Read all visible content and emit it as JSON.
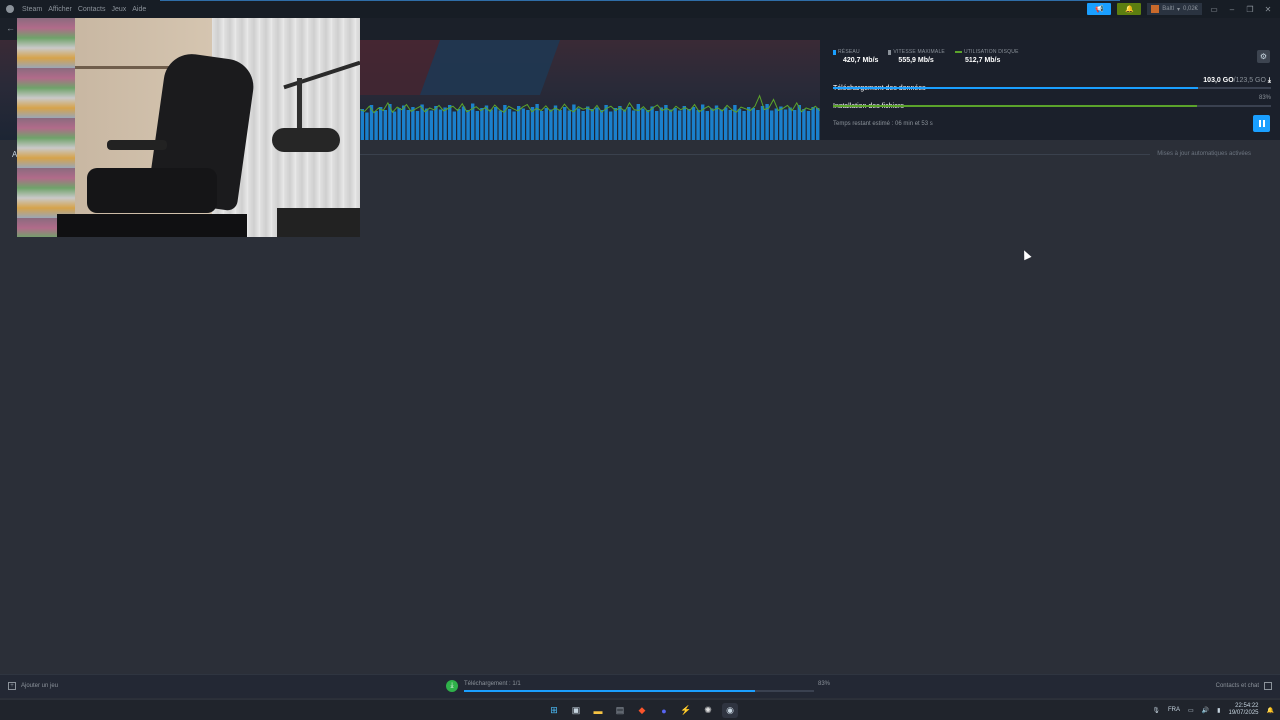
{
  "menu": {
    "items": [
      "Steam",
      "Afficher",
      "Contacts",
      "Jeux",
      "Aide"
    ]
  },
  "account": {
    "name": "Baltl",
    "balance": "0,02€"
  },
  "stats": {
    "network_label": "RÉSEAU",
    "network_value": "420,7 Mb/s",
    "max_speed_label": "VITESSE MAXIMALE",
    "max_speed_value": "555,9 Mb/s",
    "disk_label": "UTILISATION DISQUE",
    "disk_value": "512,7 Mb/s",
    "colors": {
      "network": "#1a9fff",
      "max": "#8b929a",
      "disk": "#5ba32b"
    }
  },
  "download": {
    "data_label": "Téléchargement des données",
    "data_done": "103,0 GO",
    "data_total": "/123,5 GO",
    "data_progress": 0.834,
    "install_label": "Installation des fichiers",
    "install_pct": "83%",
    "install_progress": 0.83,
    "eta": "Temps restant estimé : 06 min et 53 s"
  },
  "auto_updates": "Mises à jour automatiques activées",
  "section_letter": "A",
  "footer": {
    "add_game": "Ajouter un jeu",
    "download_status": "Téléchargement : 1/1",
    "download_pct": "83%",
    "download_progress": 0.83,
    "contacts": "Contacts et chat"
  },
  "taskbar": {
    "lang": "FRA",
    "time": "22:54:22",
    "date": "19/07/2025",
    "icons": [
      "windows-start-icon",
      "task-view-icon",
      "file-explorer-icon",
      "calculator-icon",
      "brave-icon",
      "discord-icon",
      "lightning-app-icon",
      "chatgpt-icon",
      "steam-icon"
    ]
  },
  "graph": {
    "network_bars": [
      0.62,
      0.55,
      0.7,
      0.58,
      0.66,
      0.6,
      0.72,
      0.57,
      0.64,
      0.69,
      0.6,
      0.66,
      0.58,
      0.71,
      0.63,
      0.59,
      0.68,
      0.61,
      0.65,
      0.7,
      0.57,
      0.62,
      0.67,
      0.6,
      0.73,
      0.58,
      0.64,
      0.69,
      0.61,
      0.66,
      0.59,
      0.7,
      0.62,
      0.57,
      0.68,
      0.63,
      0.6,
      0.66,
      0.72,
      0.58,
      0.64,
      0.61,
      0.69,
      0.6,
      0.66,
      0.59,
      0.71,
      0.63,
      0.58,
      0.67,
      0.62,
      0.65,
      0.6,
      0.7,
      0.57,
      0.64,
      0.68,
      0.61,
      0.66,
      0.59,
      0.72,
      0.63,
      0.6,
      0.67,
      0.58,
      0.65,
      0.7,
      0.61,
      0.64,
      0.59,
      0.68,
      0.62,
      0.66,
      0.6,
      0.71,
      0.58,
      0.63,
      0.69,
      0.61,
      0.65,
      0.6,
      0.7,
      0.62,
      0.58,
      0.66,
      0.64,
      0.6,
      0.68,
      0.72,
      0.59,
      0.63,
      0.67,
      0.61,
      0.65,
      0.6,
      0.7,
      0.62,
      0.58,
      0.66,
      0.64
    ],
    "disk_line": [
      0.62,
      0.58,
      0.7,
      0.55,
      0.66,
      0.6,
      0.78,
      0.56,
      0.68,
      0.62,
      0.74,
      0.58,
      0.64,
      0.7,
      0.57,
      0.66,
      0.61,
      0.72,
      0.59,
      0.65,
      0.7,
      0.6,
      0.76,
      0.57,
      0.63,
      0.69,
      0.6,
      0.67,
      0.58,
      0.73,
      0.62,
      0.56,
      0.7,
      0.64,
      0.59,
      0.68,
      0.74,
      0.57,
      0.65,
      0.6,
      0.71,
      0.58,
      0.66,
      0.6,
      0.75,
      0.62,
      0.57,
      0.69,
      0.63,
      0.66,
      0.59,
      0.72,
      0.56,
      0.65,
      0.7,
      0.6,
      0.67,
      0.58,
      0.78,
      0.62,
      0.6,
      0.69,
      0.57,
      0.66,
      0.73,
      0.6,
      0.65,
      0.58,
      0.7,
      0.62,
      0.67,
      0.6,
      0.74,
      0.57,
      0.64,
      0.7,
      0.6,
      0.66,
      0.59,
      0.72,
      0.62,
      0.56,
      0.68,
      0.64,
      0.6,
      0.7,
      0.95,
      0.62,
      0.66,
      0.86,
      0.6,
      0.65,
      0.72,
      0.6,
      0.78,
      0.57,
      0.66,
      0.62,
      0.7,
      0.6
    ]
  }
}
